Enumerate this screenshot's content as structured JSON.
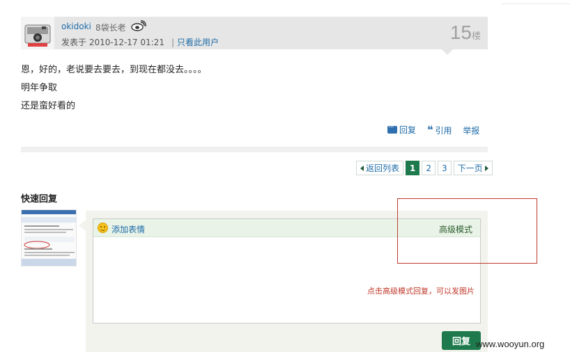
{
  "post": {
    "username": "okidoki",
    "rank": "8袋长老",
    "posted_at": "发表于 2010-12-17 01:21",
    "separator": "|",
    "only_author": "只看此用户",
    "floor_number": "15",
    "floor_unit": "楼",
    "lines": [
      "恩，好的，老说要去要去，到现在都没去。。。。",
      "明年争取",
      "还是蛮好看的"
    ],
    "actions": {
      "reply": "回复",
      "quote": "引用",
      "report": "举报"
    }
  },
  "pagination": {
    "back": "返回列表",
    "pages": [
      "1",
      "2",
      "3"
    ],
    "current": "1",
    "next": "下一页"
  },
  "quick_reply": {
    "title": "快速回复",
    "add_emoji": "添加表情",
    "advanced_mode": "高级模式",
    "hint": "点击高级模式回复，可以发图片",
    "submit": "回复"
  },
  "watermark": "www.wooyun.org",
  "colors": {
    "accent_green": "#1e7a4c",
    "link_blue": "#1f6ca8",
    "annotation_red": "#c0392b"
  }
}
